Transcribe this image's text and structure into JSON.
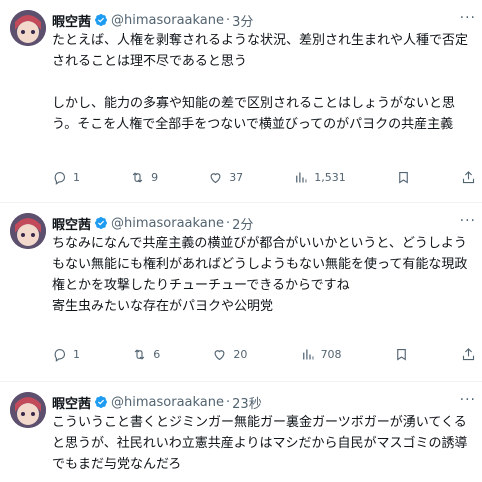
{
  "tweets": [
    {
      "name": "暇空茜",
      "handle": "@himasoraakane",
      "time": "3分",
      "text": "たとえば、人権を剥奪されるような状況、差別され生まれや人種で否定されることは理不尽であると思う\n\nしかし、能力の多寡や知能の差で区別されることはしょうがないと思う。そこを人権で全部手をつないで横並びってのがパヨクの共産主義",
      "replies": "1",
      "retweets": "9",
      "likes": "37",
      "views": "1,531"
    },
    {
      "name": "暇空茜",
      "handle": "@himasoraakane",
      "time": "2分",
      "text": "ちなみになんで共産主義の横並びが都合がいいかというと、どうしようもない無能にも権利があればどうしようもない無能を使って有能な現政権とかを攻撃したりチューチューできるからですね\n寄生虫みたいな存在がパヨクや公明党",
      "replies": "1",
      "retweets": "6",
      "likes": "20",
      "views": "708"
    },
    {
      "name": "暇空茜",
      "handle": "@himasoraakane",
      "time": "23秒",
      "text": "こういうこと書くとジミンガー無能ガー裏金ガーツボガーが湧いてくると思うが、社民れいわ立憲共産よりはマシだから自民がマスゴミの誘導でもまだ与党なんだろ"
    }
  ],
  "colors": {
    "text": "#0f1419",
    "secondary": "#536471",
    "verified": "#1d9bf0",
    "divider": "#eff3f4"
  }
}
